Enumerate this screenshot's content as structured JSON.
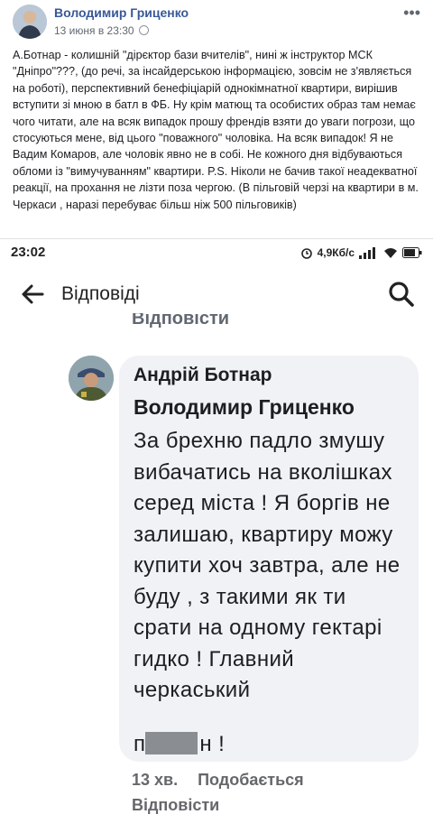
{
  "post": {
    "author": "Володимир Гриценко",
    "date": "13 июня в 23:30",
    "privacy_icon": "globe-icon",
    "menu_icon": "more-dots-icon",
    "text": "А.Ботнар - колишній \"дірєктор бази вчителів\", нині ж інструктор МСК \"Дніпро\"???, (до речі, за інсайдерською інформацією, зовсім не з'являється на роботі), перспективний бенефіціарій однокімнатної квартири, вирішив вступити зі мною в батл в ФБ. Ну крім матющ та особистих образ там немає чого читати, але на всяк випадок прошу френдів взяти до уваги погрози, що стосуються мене, від цього \"поважного\" чоловіка. На всяк випадок! Я не Вадим Комаров, але чоловік явно не в собі. Не кожного дня відбуваються обломи із \"вимучуванням\" квартири. P.S. Ніколи не бачив такої неадекватної реакції, на прохання не лізти поза чергою. (В пільговій черзі на квартири в м. Черкаси , наразі перебуває більш ніж 500 пільговиків)"
  },
  "statusbar": {
    "time": "23:02",
    "speed": "4,9Кб/с"
  },
  "appbar": {
    "title": "Відповіді",
    "back_icon": "back-arrow-icon",
    "search_icon": "search-icon"
  },
  "prev_reply": "Відповісти",
  "comment": {
    "author": "Андрій Ботнар",
    "mention": "Володимир Гриценко",
    "body": "За брехню падло змушу вибачатись на вколішках серед міста ! Я боргів не залишаю, квартиру можу купити хоч завтра, але не буду , з такими як ти срати на одному гектарі гидко ! Главний черкаський",
    "tail_start": "п",
    "tail_end": "н !",
    "age": "13 хв.",
    "like": "Подобається",
    "reply": "Відповісти"
  },
  "colors": {
    "author_link": "#385898",
    "bubble": "#f0f2f5",
    "muted": "#65676b"
  }
}
